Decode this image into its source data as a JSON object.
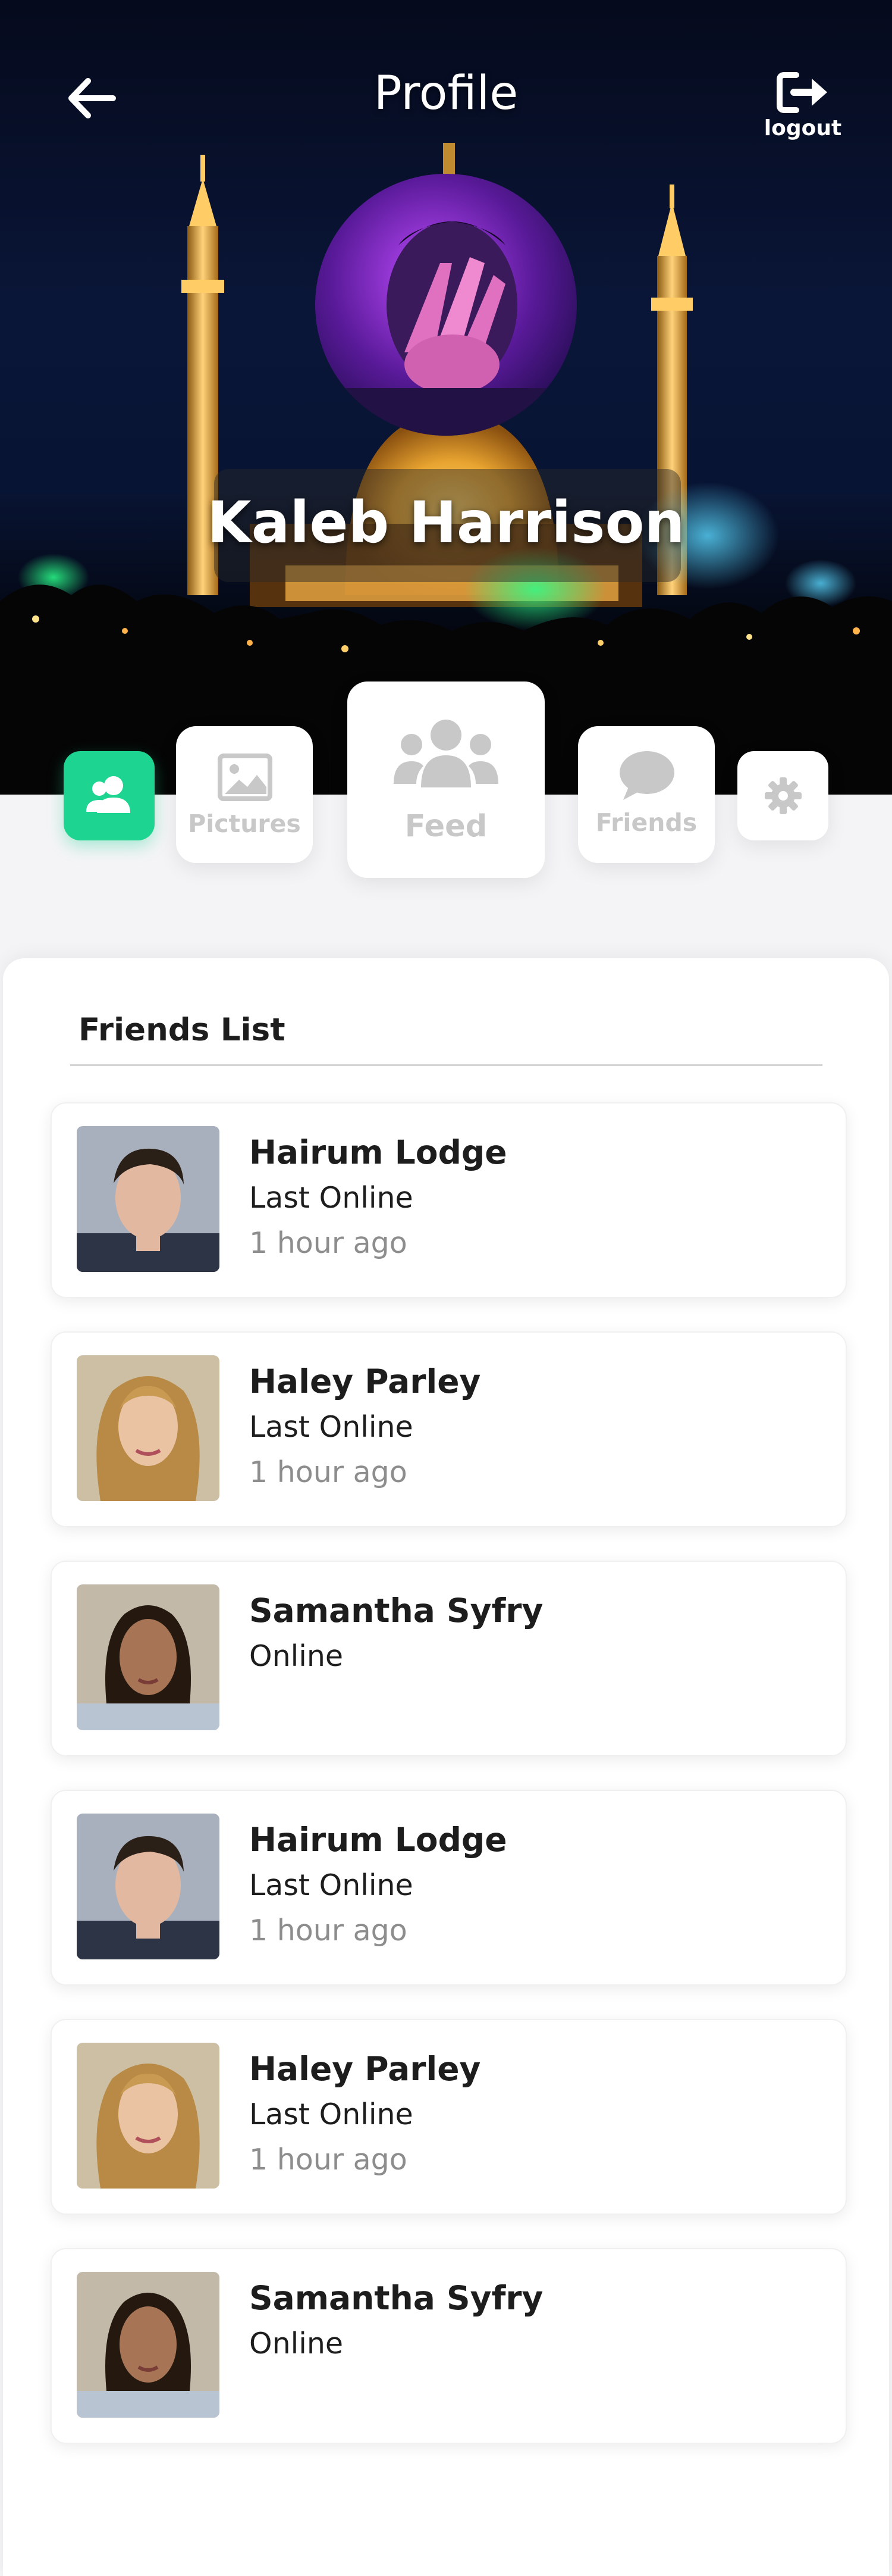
{
  "header": {
    "title": "Profile",
    "logout_label": "logout"
  },
  "profile": {
    "name": "Kaleb Harrison"
  },
  "tabs": [
    {
      "icon": "users-icon",
      "label": "",
      "active": true
    },
    {
      "icon": "image-icon",
      "label": "Pictures",
      "active": false
    },
    {
      "icon": "group-icon",
      "label": "Feed",
      "active": false
    },
    {
      "icon": "chat-bubble-icon",
      "label": "Friends",
      "active": false
    },
    {
      "icon": "gear-icon",
      "label": "",
      "active": false
    }
  ],
  "friends_section": {
    "title": "Friends List",
    "items": [
      {
        "name": "Hairum Lodge",
        "status": "Last Online",
        "time": "1 hour ago"
      },
      {
        "name": "Haley Parley",
        "status": "Last Online",
        "time": "1 hour ago"
      },
      {
        "name": "Samantha Syfry",
        "status": "Online",
        "time": ""
      },
      {
        "name": "Hairum Lodge",
        "status": "Last Online",
        "time": "1 hour ago"
      },
      {
        "name": "Haley Parley",
        "status": "Last Online",
        "time": "1 hour ago"
      },
      {
        "name": "Samantha Syfry",
        "status": "Online",
        "time": ""
      }
    ]
  },
  "colors": {
    "accent": "#1ed491",
    "inactive_icon": "#c8c8c8",
    "text_primary": "#1d1d1d",
    "text_secondary": "#8d8d8d"
  }
}
